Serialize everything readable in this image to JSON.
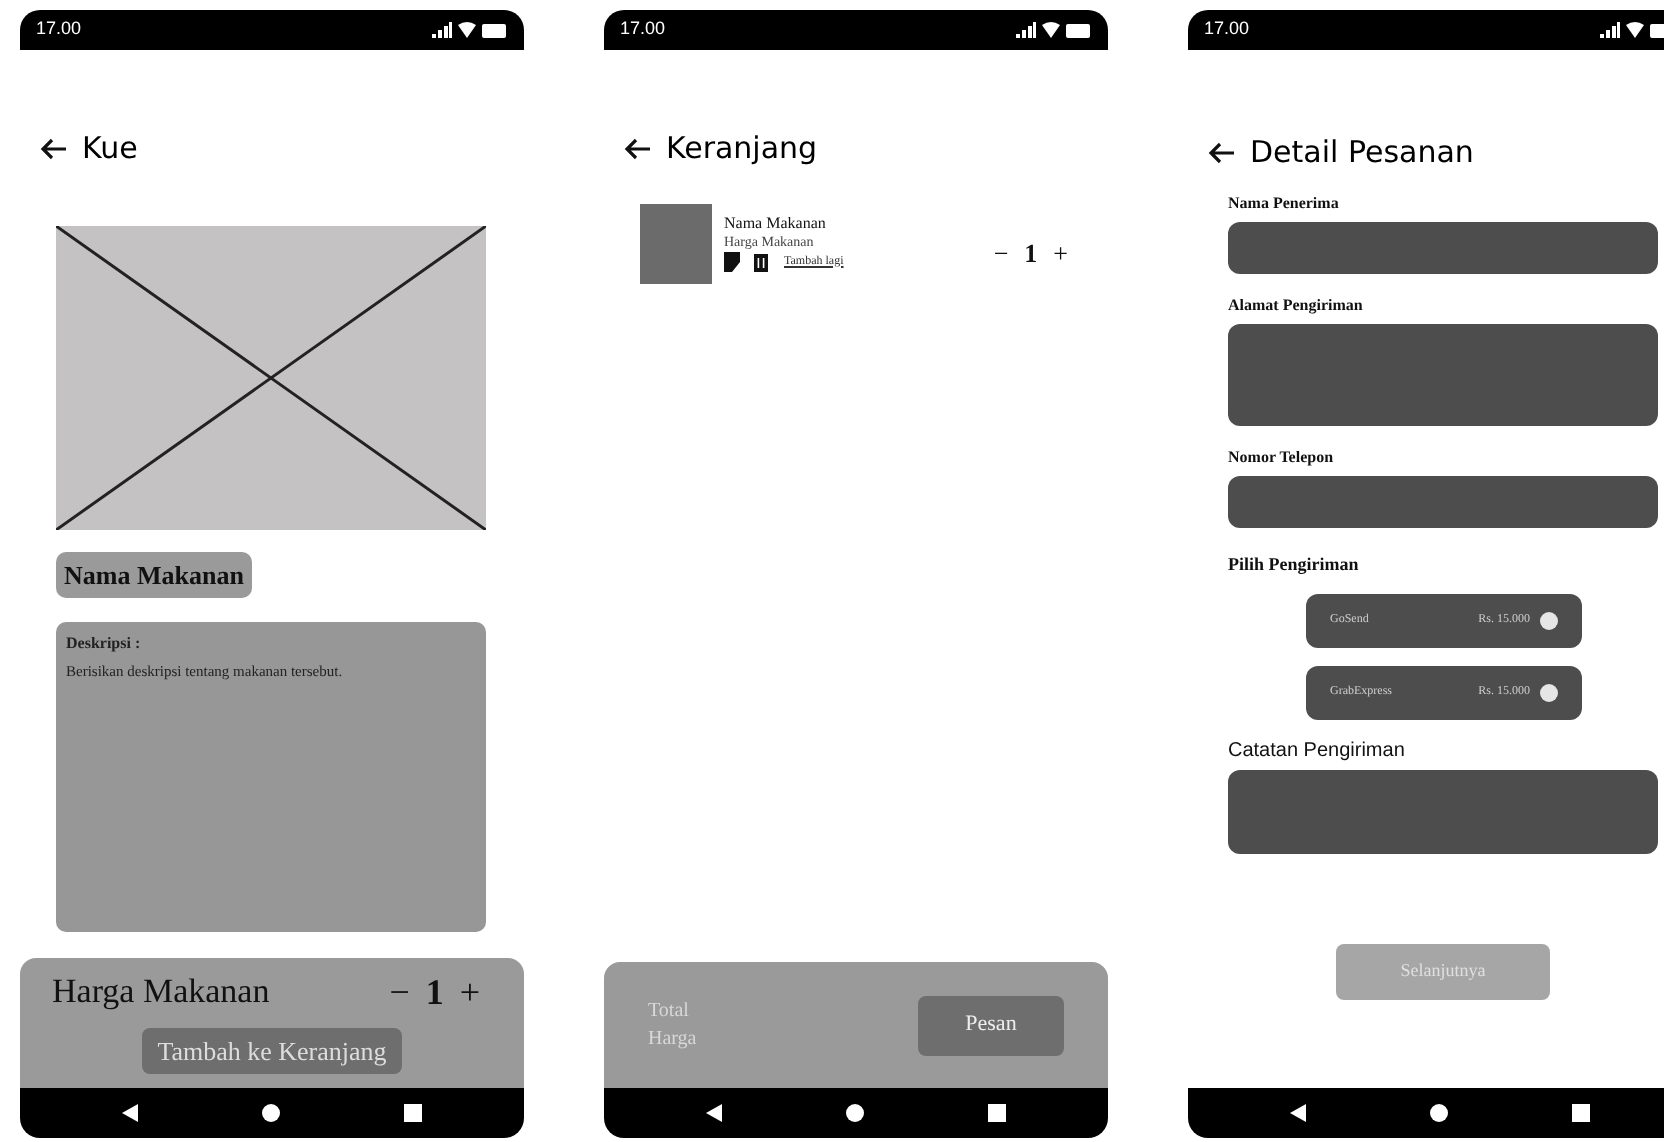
{
  "product_screen": {
    "status_time": "17.00",
    "title": "Kue",
    "food_name": "Nama Makanan",
    "description_label": "Deskripsi :",
    "description": "Berisikan deskripsi tentang makanan tersebut.",
    "price": "Harga Makanan",
    "minus": "−",
    "quantity": "1",
    "plus": "+",
    "cart_button": "Tambah ke Keranjang"
  },
  "cart_screen": {
    "status_time": "17.00",
    "title": "Keranjang",
    "items": [
      {
        "name": "Nama Makanan",
        "price": "Harga Makanan",
        "link": "Tambah lagi",
        "minus": "−",
        "quantity": "1",
        "plus": "+"
      }
    ],
    "total_label": "Total Harga",
    "order_button": "Pesan"
  },
  "order_detail_screen": {
    "status_time": "17.00",
    "title": "Detail Pesanan",
    "fields": [
      {
        "label": "Nama Penerima",
        "kind": "single"
      },
      {
        "label": "Alamat Pengiriman",
        "kind": "multi"
      },
      {
        "label": "Nomor Telepon",
        "kind": "single"
      }
    ],
    "shipping_label": "Pilih Pengiriman",
    "shipping_options": [
      {
        "name": "GoSend",
        "price": "Rs. 15.000",
        "selected": false
      },
      {
        "name": "GrabExpress",
        "price": "Rs. 15.000",
        "selected": false
      }
    ],
    "notes_label": "Catatan Pengiriman",
    "next_button": "Selanjutnya"
  }
}
